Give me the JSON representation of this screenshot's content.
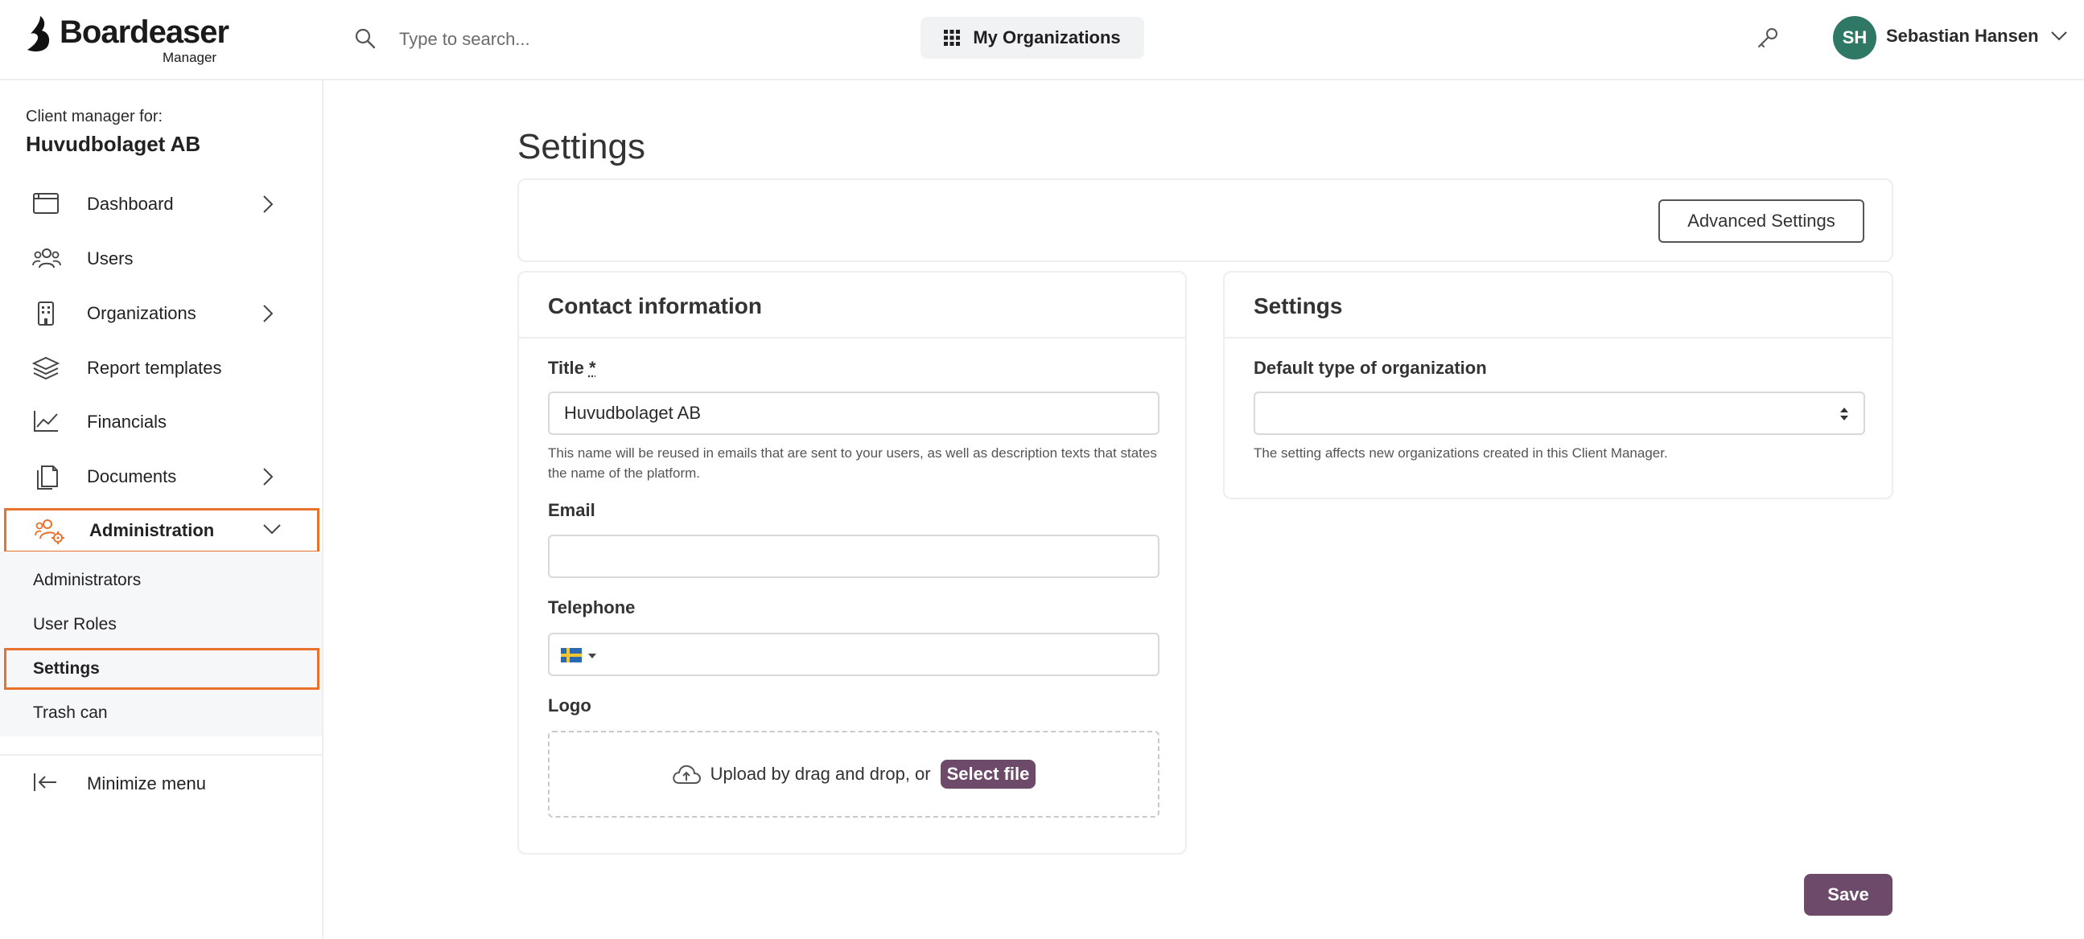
{
  "brand": {
    "name": "Boardeaser",
    "sub": "Manager"
  },
  "search": {
    "placeholder": "Type to search..."
  },
  "header": {
    "my_orgs_label": "My Organizations",
    "user": {
      "initials": "SH",
      "name": "Sebastian Hansen",
      "avatar_color": "#2f7865"
    }
  },
  "sidebar": {
    "client_label": "Client manager for:",
    "client_name": "Huvudbolaget AB",
    "items": [
      {
        "label": "Dashboard",
        "icon": "browser-window-icon",
        "has_children": true
      },
      {
        "label": "Users",
        "icon": "users-icon",
        "has_children": false
      },
      {
        "label": "Organizations",
        "icon": "building-icon",
        "has_children": true
      },
      {
        "label": "Report templates",
        "icon": "layers-icon",
        "has_children": false
      },
      {
        "label": "Financials",
        "icon": "line-chart-icon",
        "has_children": false
      },
      {
        "label": "Documents",
        "icon": "documents-icon",
        "has_children": true
      },
      {
        "label": "Administration",
        "icon": "admin-users-gear-icon",
        "has_children": true,
        "expanded": true,
        "active": true
      }
    ],
    "subitems": [
      {
        "label": "Administrators"
      },
      {
        "label": "User Roles"
      },
      {
        "label": "Settings",
        "active": true
      },
      {
        "label": "Trash can"
      }
    ],
    "minimize_label": "Minimize menu",
    "highlight_color": "#e8712b"
  },
  "main": {
    "title": "Settings",
    "advanced_settings_label": "Advanced Settings",
    "contact": {
      "heading": "Contact information",
      "title_label": "Title",
      "title_required": "*",
      "title_value": "Huvudbolaget AB",
      "title_help": "This name will be reused in emails that are sent to your users, as well as description texts that states the name of the platform.",
      "email_label": "Email",
      "email_value": "",
      "telephone_label": "Telephone",
      "telephone_value": "",
      "telephone_country": "SE",
      "logo_label": "Logo",
      "upload_text": "Upload by drag and drop, or",
      "select_file_label": "Select file"
    },
    "settings": {
      "heading": "Settings",
      "default_type_label": "Default type of organization",
      "default_type_value": "",
      "default_type_help": "The setting affects new organizations created in this Client Manager."
    },
    "save_label": "Save",
    "accent_color": "#6d4a6a"
  }
}
